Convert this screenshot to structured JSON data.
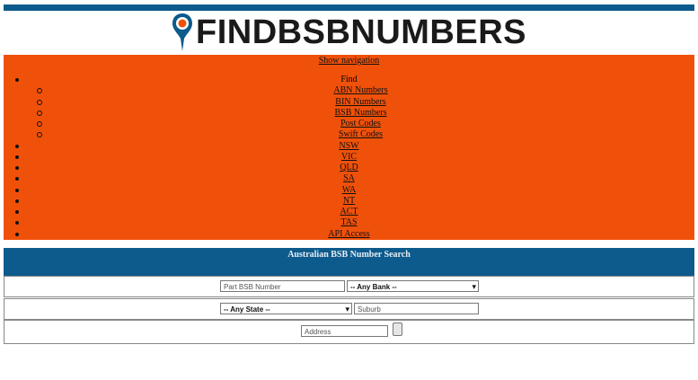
{
  "logo": {
    "text": "FINDBSBNUMBERS"
  },
  "colors": {
    "brand_blue": "#0d5a8c",
    "nav_orange": "#f0510a",
    "pin_orange": "#f0510a"
  },
  "nav": {
    "toggle_label": "Show navigation",
    "find_label": "Find",
    "find_items": [
      "ABN Numbers",
      "BIN Numbers",
      "BSB Numbers",
      "Post Codes",
      "Swift Codes"
    ],
    "states": [
      "NSW",
      "VIC",
      "QLD",
      "SA",
      "WA",
      "NT",
      "ACT",
      "TAS"
    ],
    "api_label": "API Access"
  },
  "search": {
    "title": "Australian BSB Number Search",
    "bsb_placeholder": "Part BSB Number",
    "bank_selected": "-- Any Bank --",
    "state_selected": "-- Any State --",
    "suburb_placeholder": "Suburb",
    "address_placeholder": "Address"
  }
}
